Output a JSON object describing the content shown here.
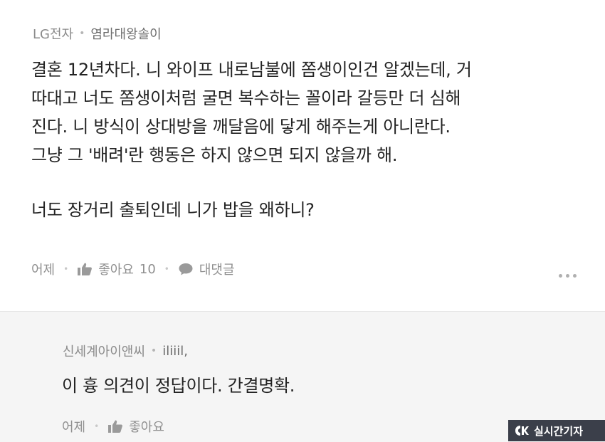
{
  "comment": {
    "source": "LG전자",
    "author": "염라대왕솔이",
    "lines": [
      "결혼 12년차다. 니 와이프 내로남불에 쫌생이인건 알겠는데, 거",
      "따대고 너도 쫌생이처럼 굴면 복수하는 꼴이라 갈등만 더 심해",
      "진다. 니 방식이 상대방을 깨달음에 닿게 해주는게 아니란다.",
      "그냥 그 '배려'란 행동은 하지 않으면 되지 않을까 해."
    ],
    "last_line": "너도 장거리 출퇴인데 니가 밥을 왜하니?",
    "time": "어제",
    "like_label": "좋아요",
    "like_count": "10",
    "reply_label": "대댓글"
  },
  "reply": {
    "source": "신세계아이앤씨",
    "author": "iliiil,",
    "text": "이 흉 의견이 정답이다. 간결명확.",
    "time": "어제",
    "like_label": "좋아요"
  },
  "watermark": {
    "text": "실시간기자"
  },
  "icons": {
    "like": "thumbs-up-icon",
    "reply": "speech-bubble-icon",
    "more": "more-dots-icon"
  }
}
